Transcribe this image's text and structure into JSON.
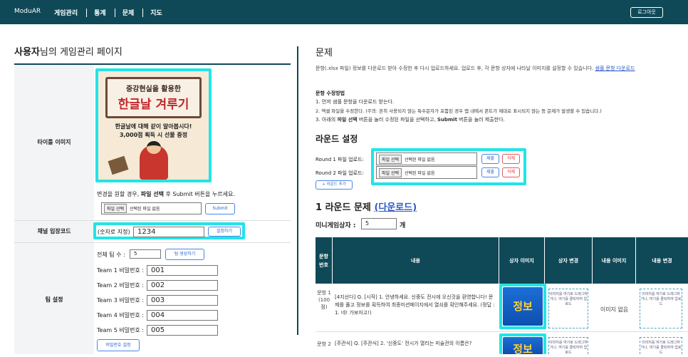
{
  "topbar": {
    "brand": "ModuAR",
    "nav": [
      "게임관리",
      "통계",
      "문제",
      "지도"
    ],
    "logout": "로그아웃"
  },
  "left": {
    "title_user": "사용자",
    "title_rest": "님의 게임관리 페이지",
    "title_image_label": "타이틀 이미지",
    "poster": {
      "subtitle": "중강현실을 활용한",
      "headline": "한글날 겨루기",
      "body1": "한글날에 대해 같이 알아봅시다!",
      "body2": "3,000점 획득 시 선물 증정"
    },
    "change_note_pre": "변경을 원할 경우, ",
    "change_note_bold": "파일 선택",
    "change_note_post": " 후 Submit 버튼을 누르세요.",
    "file_button": "파일 선택",
    "file_none": "선택된 파일 없음",
    "submit": "Submit",
    "channel_label": "채널 입장코드",
    "channel_hint": "(숫자로 지정)",
    "channel_code": "1234",
    "channel_set": "설정하기",
    "team_label": "팀 설정",
    "team_count_label": "전체 팀 수 :",
    "team_count": "5",
    "team_gen": "팀 생성하기",
    "teams": [
      {
        "label": "Team 1 비밀번호 :",
        "pw": "001"
      },
      {
        "label": "Team 2 비밀번호 :",
        "pw": "002"
      },
      {
        "label": "Team 3 비밀번호 :",
        "pw": "003"
      },
      {
        "label": "Team 4 비밀번호 :",
        "pw": "004"
      },
      {
        "label": "Team 5 비밀번호 :",
        "pw": "005"
      }
    ],
    "pw_set": "비밀번호 설정"
  },
  "right": {
    "title": "문제",
    "desc": "문항(.xlsx 파일) 정보를 다운로드 받아 수정한 후 다시 업로드하세요. 업로드 후, 각 문항 상자에 나타날 이미지를 설정할 수 있습니다.",
    "sample_link": "샘플 문항 다운로드",
    "howto_title": "문항 수정방법",
    "howto1": "1. 먼저 샘플 문항을 다운로드 받는다.",
    "howto2": "2. 엑셀 파일을 수정한다. (주의: 흔히 사용되지 않는 특수문자가 포함된 경우 앱 내에서 폰트가 제대로 표시되지 않는 등 문제가 발생할 수 있습니다.)",
    "howto3_pre": "3. 아래의 ",
    "howto3_b1": "파일 선택",
    "howto3_mid": " 버튼을 눌러 수정된 파일을 선택하고, ",
    "howto3_b2": "Submit",
    "howto3_post": " 버튼을 눌러 제출한다.",
    "round_title": "라운드 설정",
    "rounds": [
      {
        "label": "Round 1 파일 업로드:"
      },
      {
        "label": "Round 2 파일 업로드:"
      }
    ],
    "submit_btn": "제출",
    "delete_btn": "삭제",
    "add_round": "+ 라운드 추가",
    "round_problem": "1 라운드 문제 ",
    "download_link": "(다운로드)",
    "mini_label": "미니게임상자 :",
    "mini_value": "5",
    "mini_unit": "개",
    "table_headers": [
      "문항번호",
      "내용",
      "상자 이미지",
      "상자 변경",
      "내용 이미지",
      "내용 변경"
    ],
    "rows": [
      {
        "num": "문항 1 (100 점)",
        "content": "[4지선다] Q. [시작] 1. 안녕하세요. 신중도 전시에 오신것을 환영합니다! 문제를 풀고 정보를 획득하여 최종미션페이지에서 열쇠를 확인해주세요. (정답 : 1. 네! 가보자고!)",
        "box_img": "정보",
        "drop": "이미지를 여기로 드래그하거나, 여기를 클릭하여 업로드",
        "content_img": "이미지 없음"
      },
      {
        "num": "문항 2",
        "content": "[주관식] Q. [주관식] 2. '신중도' 전시가 열리는 미술관의 이름은?",
        "box_img": "정보",
        "drop": "이미지를 여기로 드래그하거나, 여기를 클릭하여 업로드",
        "content_img": ""
      }
    ]
  }
}
